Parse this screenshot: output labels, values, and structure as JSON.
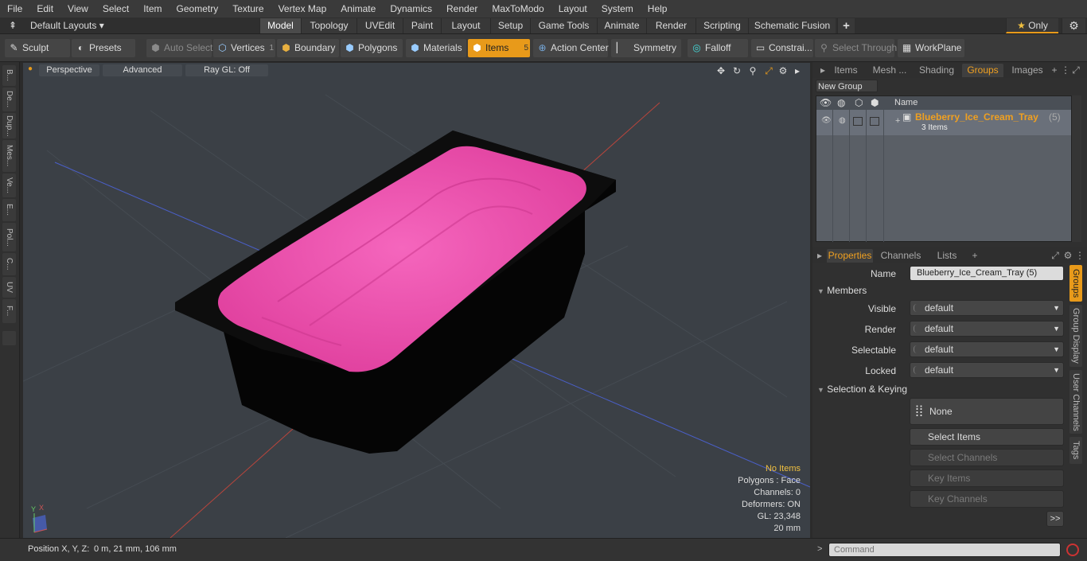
{
  "menubar": {
    "items": [
      "File",
      "Edit",
      "View",
      "Select",
      "Item",
      "Geometry",
      "Texture",
      "Vertex Map",
      "Animate",
      "Dynamics",
      "Render",
      "MaxToModo",
      "Layout",
      "System",
      "Help"
    ]
  },
  "tabbar": {
    "layout_label": "Default Layouts",
    "tabs": [
      "Model",
      "Topology",
      "UVEdit",
      "Paint",
      "Layout",
      "Setup",
      "Game Tools",
      "Animate",
      "Render",
      "Scripting",
      "Schematic Fusion"
    ],
    "active_tab": "Model",
    "only_label": "Only"
  },
  "toolbar": {
    "sculpt": "Sculpt",
    "presets": "Presets",
    "auto_select": "Auto Select",
    "vertices": "Vertices",
    "vertices_count": "1",
    "boundary": "Boundary",
    "polygons": "Polygons",
    "materials": "Materials",
    "items": "Items",
    "items_count": "5",
    "action_center": "Action Center",
    "symmetry": "Symmetry",
    "falloff": "Falloff",
    "constraints": "Constrai...",
    "select_through": "Select Through",
    "workplane": "WorkPlane"
  },
  "left_tabs": [
    "B...",
    "De...",
    "Dup...",
    "Mes...",
    "Ve...",
    "E...",
    "Pol...",
    "C...",
    "UV",
    "F..."
  ],
  "viewport": {
    "perspective": "Perspective",
    "advanced": "Advanced",
    "raygl": "Ray GL: Off",
    "info": {
      "no_items": "No Items",
      "polygons": "Polygons : Face",
      "channels": "Channels: 0",
      "deformers": "Deformers: ON",
      "gl": "GL: 23,348",
      "unit": "20 mm"
    },
    "colors": {
      "background": "#3b4046",
      "tray": "#050505",
      "ice_cream": "#f055b0"
    }
  },
  "groups_panel": {
    "tabs": [
      "Items",
      "Mesh ...",
      "Shading",
      "Groups",
      "Images"
    ],
    "active_tab": "Groups",
    "new_group": "New Group",
    "column_name": "Name",
    "group_name": "Blueberry_Ice_Cream_Tray",
    "group_count": "(5)",
    "group_items": "3 Items"
  },
  "properties": {
    "tabs": [
      "Properties",
      "Channels",
      "Lists"
    ],
    "active_tab": "Properties",
    "name_label": "Name",
    "name_value": "Blueberry_Ice_Cream_Tray (5)",
    "members": "Members",
    "visible_label": "Visible",
    "visible_value": "default",
    "render_label": "Render",
    "render_value": "default",
    "selectable_label": "Selectable",
    "selectable_value": "default",
    "locked_label": "Locked",
    "locked_value": "default",
    "selection_keying": "Selection & Keying",
    "none_label": "None",
    "select_items": "Select Items",
    "select_channels": "Select Channels",
    "key_items": "Key Items",
    "key_channels": "Key Channels",
    "more": ">>"
  },
  "right_vtabs": [
    "Groups",
    "Group Display",
    "User Channels",
    "Tags"
  ],
  "statusbar": {
    "position_label": "Position X, Y, Z:",
    "position_value": "0 m, 21 mm, 106 mm",
    "command_placeholder": "Command"
  }
}
